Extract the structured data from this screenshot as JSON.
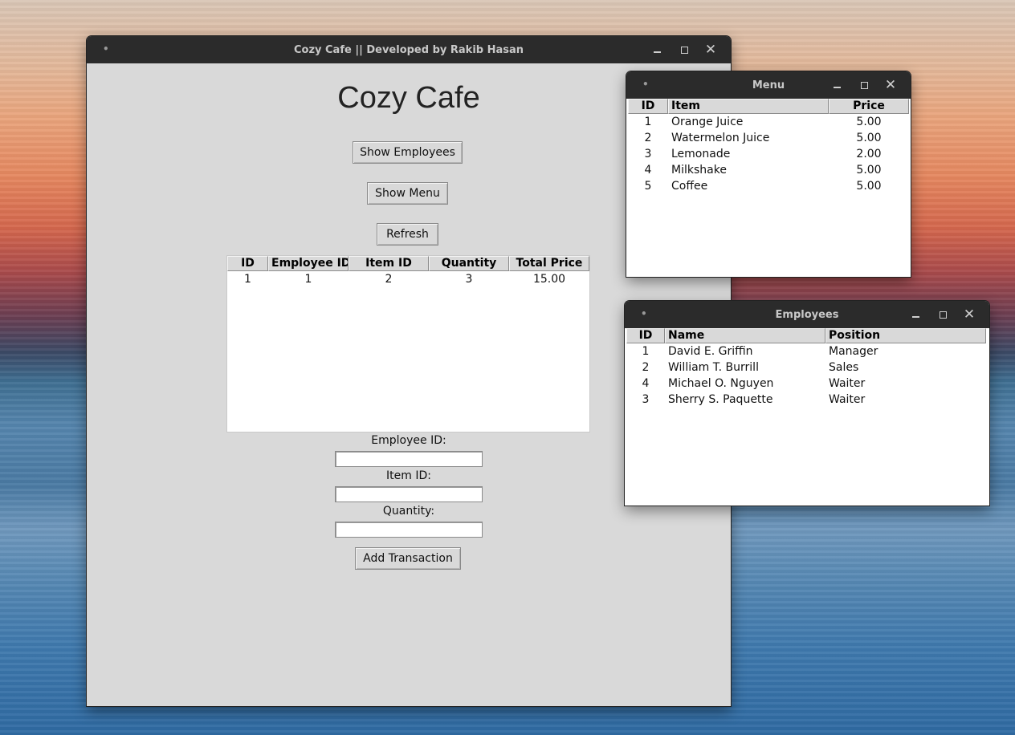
{
  "main_window": {
    "title": "Cozy Cafe || Developed by Rakib Hasan",
    "heading": "Cozy Cafe",
    "buttons": {
      "show_employees": "Show Employees",
      "show_menu": "Show Menu",
      "refresh": "Refresh",
      "add_transaction": "Add Transaction"
    },
    "transactions": {
      "columns": [
        "ID",
        "Employee ID",
        "Item ID",
        "Quantity",
        "Total Price"
      ],
      "rows": [
        [
          "1",
          "1",
          "2",
          "3",
          "15.00"
        ]
      ]
    },
    "form": {
      "employee_id_label": "Employee ID:",
      "employee_id_value": "",
      "item_id_label": "Item ID:",
      "item_id_value": "",
      "quantity_label": "Quantity:",
      "quantity_value": ""
    }
  },
  "menu_window": {
    "title": "Menu",
    "columns": [
      "ID",
      "Item",
      "Price"
    ],
    "rows": [
      [
        "1",
        "Orange Juice",
        "5.00"
      ],
      [
        "2",
        "Watermelon Juice",
        "5.00"
      ],
      [
        "3",
        "Lemonade",
        "2.00"
      ],
      [
        "4",
        "Milkshake",
        "5.00"
      ],
      [
        "5",
        "Coffee",
        "5.00"
      ]
    ]
  },
  "employees_window": {
    "title": "Employees",
    "columns": [
      "ID",
      "Name",
      "Position"
    ],
    "rows": [
      [
        "1",
        "David E. Griffin",
        "Manager"
      ],
      [
        "2",
        "William T. Burrill",
        "Sales"
      ],
      [
        "4",
        "Michael O. Nguyen",
        "Waiter"
      ],
      [
        "3",
        "Sherry S. Paquette",
        "Waiter"
      ]
    ]
  },
  "titlebar_icons": [
    "window-menu-icon",
    "minimize-icon",
    "maximize-icon",
    "close-icon"
  ]
}
